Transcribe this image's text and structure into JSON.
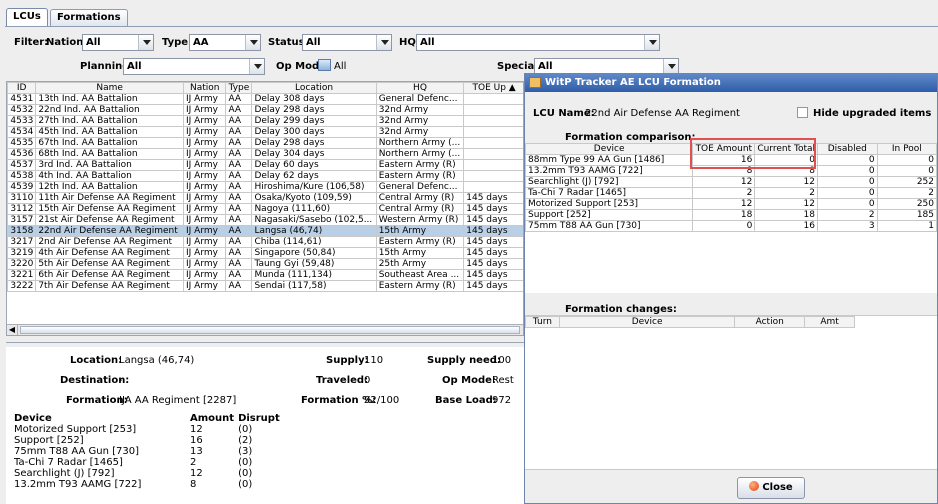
{
  "tabs": [
    {
      "label": "LCUs"
    },
    {
      "label": "Formations"
    }
  ],
  "filters": {
    "filter_label": "Filter:",
    "nation_label": "Nation:",
    "nation_value": "All",
    "type_label": "Type:",
    "type_value": "AA",
    "status_label": "Status:",
    "status_value": "All",
    "hq_label": "HQ:",
    "hq_value": "All",
    "planning_label": "Planning:",
    "planning_value": "All",
    "opmode_label": "Op Mode:",
    "opmode_value": "All",
    "special_label": "Special:",
    "special_value": "All"
  },
  "unit_table": {
    "columns": [
      "ID",
      "Name",
      "Nation",
      "Type",
      "Location",
      "HQ",
      "TOE Up ▲"
    ],
    "rows": [
      [
        "4531",
        "13th Ind. AA Battalion",
        "IJ Army",
        "AA",
        "Delay 308 days",
        "General Defenc...",
        ""
      ],
      [
        "4532",
        "22nd Ind. AA Battalion",
        "IJ Army",
        "AA",
        "Delay 298 days",
        "32nd Army",
        ""
      ],
      [
        "4533",
        "27th Ind. AA Battalion",
        "IJ Army",
        "AA",
        "Delay 299 days",
        "32nd Army",
        ""
      ],
      [
        "4534",
        "45th Ind. AA Battalion",
        "IJ Army",
        "AA",
        "Delay 300 days",
        "32nd Army",
        ""
      ],
      [
        "4535",
        "67th Ind. AA Battalion",
        "IJ Army",
        "AA",
        "Delay 298 days",
        "Northern Army (...",
        ""
      ],
      [
        "4536",
        "68th Ind. AA Battalion",
        "IJ Army",
        "AA",
        "Delay 304 days",
        "Northern Army (...",
        ""
      ],
      [
        "4537",
        "3rd Ind. AA Battalion",
        "IJ Army",
        "AA",
        "Delay 60 days",
        "Eastern Army (R)",
        ""
      ],
      [
        "4538",
        "4th Ind. AA Battalion",
        "IJ Army",
        "AA",
        "Delay 62 days",
        "Eastern Army (R)",
        ""
      ],
      [
        "4539",
        "12th Ind. AA Battalion",
        "IJ Army",
        "AA",
        "Hiroshima/Kure (106,58)",
        "General Defenc...",
        ""
      ],
      [
        "3110",
        "11th Air Defense AA Regiment",
        "IJ Army",
        "AA",
        "Osaka/Kyoto (109,59)",
        "Central Army (R)",
        "145 days"
      ],
      [
        "3112",
        "15th Air Defense AA Regiment",
        "IJ Army",
        "AA",
        "Nagoya (111,60)",
        "Central Army (R)",
        "145 days"
      ],
      [
        "3157",
        "21st Air Defense AA Regiment",
        "IJ Army",
        "AA",
        "Nagasaki/Sasebo (102,5...",
        "Western Army (R)",
        "145 days"
      ],
      [
        "3158",
        "22nd Air Defense AA Regiment",
        "IJ Army",
        "AA",
        "Langsa (46,74)",
        "15th Army",
        "145 days"
      ],
      [
        "3217",
        "2nd Air Defense AA Regiment",
        "IJ Army",
        "AA",
        "Chiba (114,61)",
        "Eastern Army (R)",
        "145 days"
      ],
      [
        "3219",
        "4th Air Defense AA Regiment",
        "IJ Army",
        "AA",
        "Singapore (50,84)",
        "15th Army",
        "145 days"
      ],
      [
        "3220",
        "5th Air Defense AA Regiment",
        "IJ Army",
        "AA",
        "Taung Gyi (59,48)",
        "25th Army",
        "145 days"
      ],
      [
        "3221",
        "6th Air Defense AA Regiment",
        "IJ Army",
        "AA",
        "Munda (111,134)",
        "Southeast Area ...",
        "145 days"
      ],
      [
        "3222",
        "7th Air Defense AA Regiment",
        "IJ Army",
        "AA",
        "Sendai (117,58)",
        "Eastern Army (R)",
        "145 days"
      ]
    ],
    "selected_index": 12
  },
  "details": {
    "location_label": "Location:",
    "location_value": "Langsa (46,74)",
    "destination_label": "Destination:",
    "destination_value": "-",
    "formation_label": "Formation:",
    "formation_value": "IJA AA Regiment [2287]",
    "supply_label": "Supply:",
    "supply_value": "110",
    "supply_need_label": "Supply need:",
    "supply_need_value": "100",
    "traveled_label": "Traveled:",
    "traveled_value": "0",
    "opmode_label": "Op Mode:",
    "opmode_value": "Rest",
    "formation_pct_label": "Formation %:",
    "formation_pct_value": "92/100",
    "base_load_label": "Base Load:",
    "base_load_value": "972",
    "device_header": [
      "Device",
      "Amount",
      "Disrupt"
    ],
    "devices": [
      [
        "Motorized Support [253]",
        "12",
        "(0)"
      ],
      [
        "Support [252]",
        "16",
        "(2)"
      ],
      [
        "75mm T88 AA Gun [730]",
        "13",
        "(3)"
      ],
      [
        "Ta-Chi 7 Radar [1465]",
        "2",
        "(0)"
      ],
      [
        "Searchlight (J) [792]",
        "12",
        "(0)"
      ],
      [
        "13.2mm T93 AAMG [722]",
        "8",
        "(0)"
      ]
    ]
  },
  "dialog": {
    "title": "WitP Tracker AE LCU Formation",
    "lcu_name_label": "LCU Name:",
    "lcu_name_value": "22nd Air Defense AA Regiment",
    "hide_upgraded_label": "Hide upgraded items",
    "comparison_label": "Formation comparison:",
    "comparison_columns": [
      "Device",
      "TOE Amount",
      "Current Total",
      "Disabled",
      "In Pool"
    ],
    "comparison_rows": [
      [
        "88mm Type 99 AA Gun [1486]",
        "16",
        "0",
        "0",
        "0"
      ],
      [
        "13.2mm T93 AAMG [722]",
        "8",
        "8",
        "0",
        "0"
      ],
      [
        "Searchlight (J) [792]",
        "12",
        "12",
        "0",
        "252"
      ],
      [
        "Ta-Chi 7 Radar [1465]",
        "2",
        "2",
        "0",
        "2"
      ],
      [
        "Motorized Support [253]",
        "12",
        "12",
        "0",
        "250"
      ],
      [
        "Support [252]",
        "18",
        "18",
        "2",
        "185"
      ],
      [
        "75mm T88 AA Gun [730]",
        "0",
        "16",
        "3",
        "1"
      ]
    ],
    "changes_label": "Formation changes:",
    "changes_columns": [
      "Turn",
      "Device",
      "Action",
      "Amt"
    ],
    "close_label": "Close",
    "accent_highlight": "#e05050"
  }
}
